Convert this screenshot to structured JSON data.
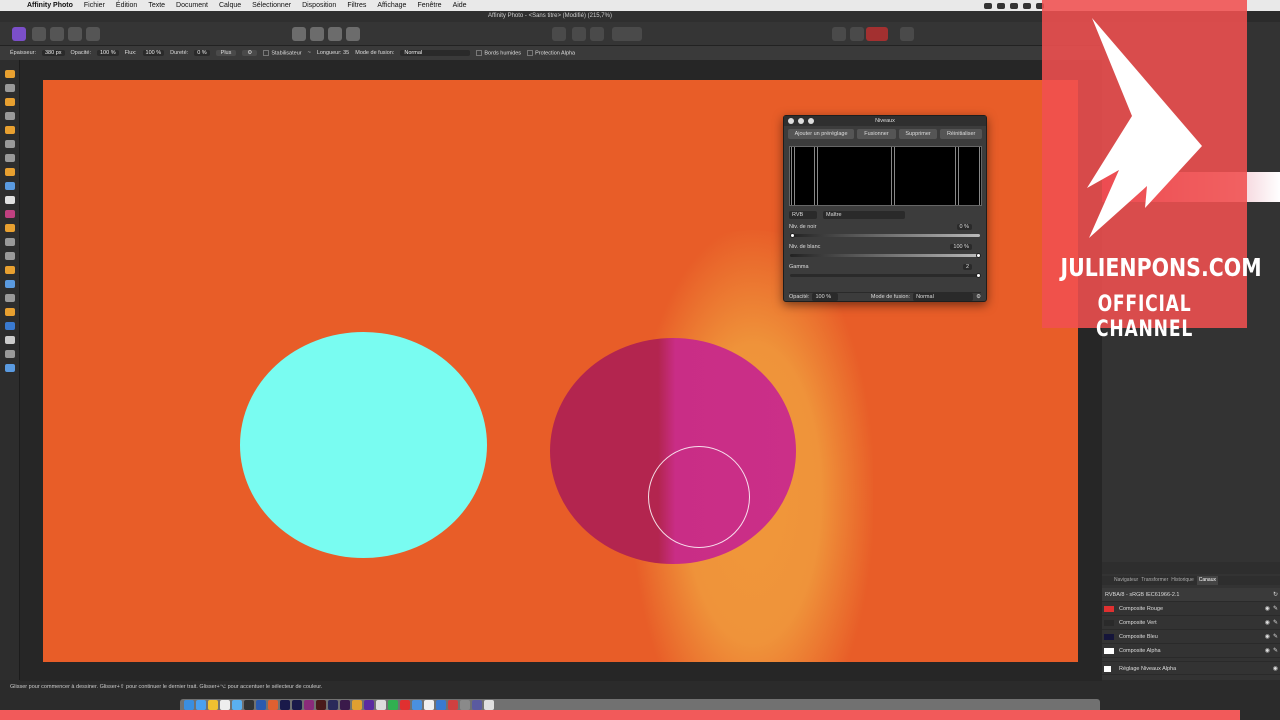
{
  "menubar": {
    "items": [
      "Affinity Photo",
      "Fichier",
      "Édition",
      "Texte",
      "Document",
      "Calque",
      "Sélectionner",
      "Disposition",
      "Filtres",
      "Affichage",
      "Fenêtre",
      "Aide"
    ]
  },
  "window": {
    "title": "Affinity Photo - <Sans titre> (Modifié) (215,7%)"
  },
  "context_bar": {
    "thickness_label": "Épaisseur:",
    "thickness_value": "380 px",
    "opacity_label": "Opacité:",
    "opacity_value": "100 %",
    "flow_label": "Flux:",
    "flow_value": "100 %",
    "hardness_label": "Dureté:",
    "hardness_value": "0 %",
    "more_label": "Plus",
    "stabilizer_label": "Stabilisateur",
    "length_label": "Longueur: 35",
    "blend_label": "Mode de fusion:",
    "blend_value": "Normal",
    "wet_edges_label": "Bords humides",
    "alpha_protect_label": "Protection Alpha"
  },
  "levels_panel": {
    "title": "Niveaux",
    "add_preset": "Ajouter un préréglage",
    "merge": "Fusionner",
    "delete": "Supprimer",
    "reset": "Réinitialiser",
    "channel_value": "RVB",
    "channel_mode": "Maître",
    "black_label": "Niv. de noir",
    "black_value": "0 %",
    "white_label": "Niv. de blanc",
    "white_value": "100 %",
    "gamma_label": "Gamma",
    "gamma_value": "2",
    "opacity_label": "Opacité:",
    "opacity_value": "100 %",
    "blend_label": "Mode de fusion:",
    "blend_value": "Normal"
  },
  "right_panel": {
    "tabs": [
      "Navigateur",
      "Transformer",
      "Historique",
      "Canaux"
    ],
    "active_tab": "Canaux",
    "doc_profile": "RVBA/8 - sRGB IEC61966-2.1",
    "channels": [
      {
        "label": "Composite Rouge",
        "color": "#e03030"
      },
      {
        "label": "Composite Vert",
        "color": "#2a2a2a"
      },
      {
        "label": "Composite Bleu",
        "color": "#15153a"
      },
      {
        "label": "Composite Alpha",
        "color": "#ffffff"
      }
    ],
    "adjust_label": "Réglage Niveaux Alpha"
  },
  "status": {
    "text": "Glisser pour commencer à dessiner. Glisser+⇧ pour continuer le dernier trait. Glisser+⌥ pour accentuer le sélecteur de couleur."
  },
  "overlay": {
    "line1": "JULIENPONS.COM",
    "line2": "OFFICIAL CHANNEL"
  },
  "colors": {
    "canvas_bg": "#e85d28",
    "cyan_circle": "#79fcf1",
    "magenta_circle": "#c92d86",
    "overlay": "#f05050"
  }
}
